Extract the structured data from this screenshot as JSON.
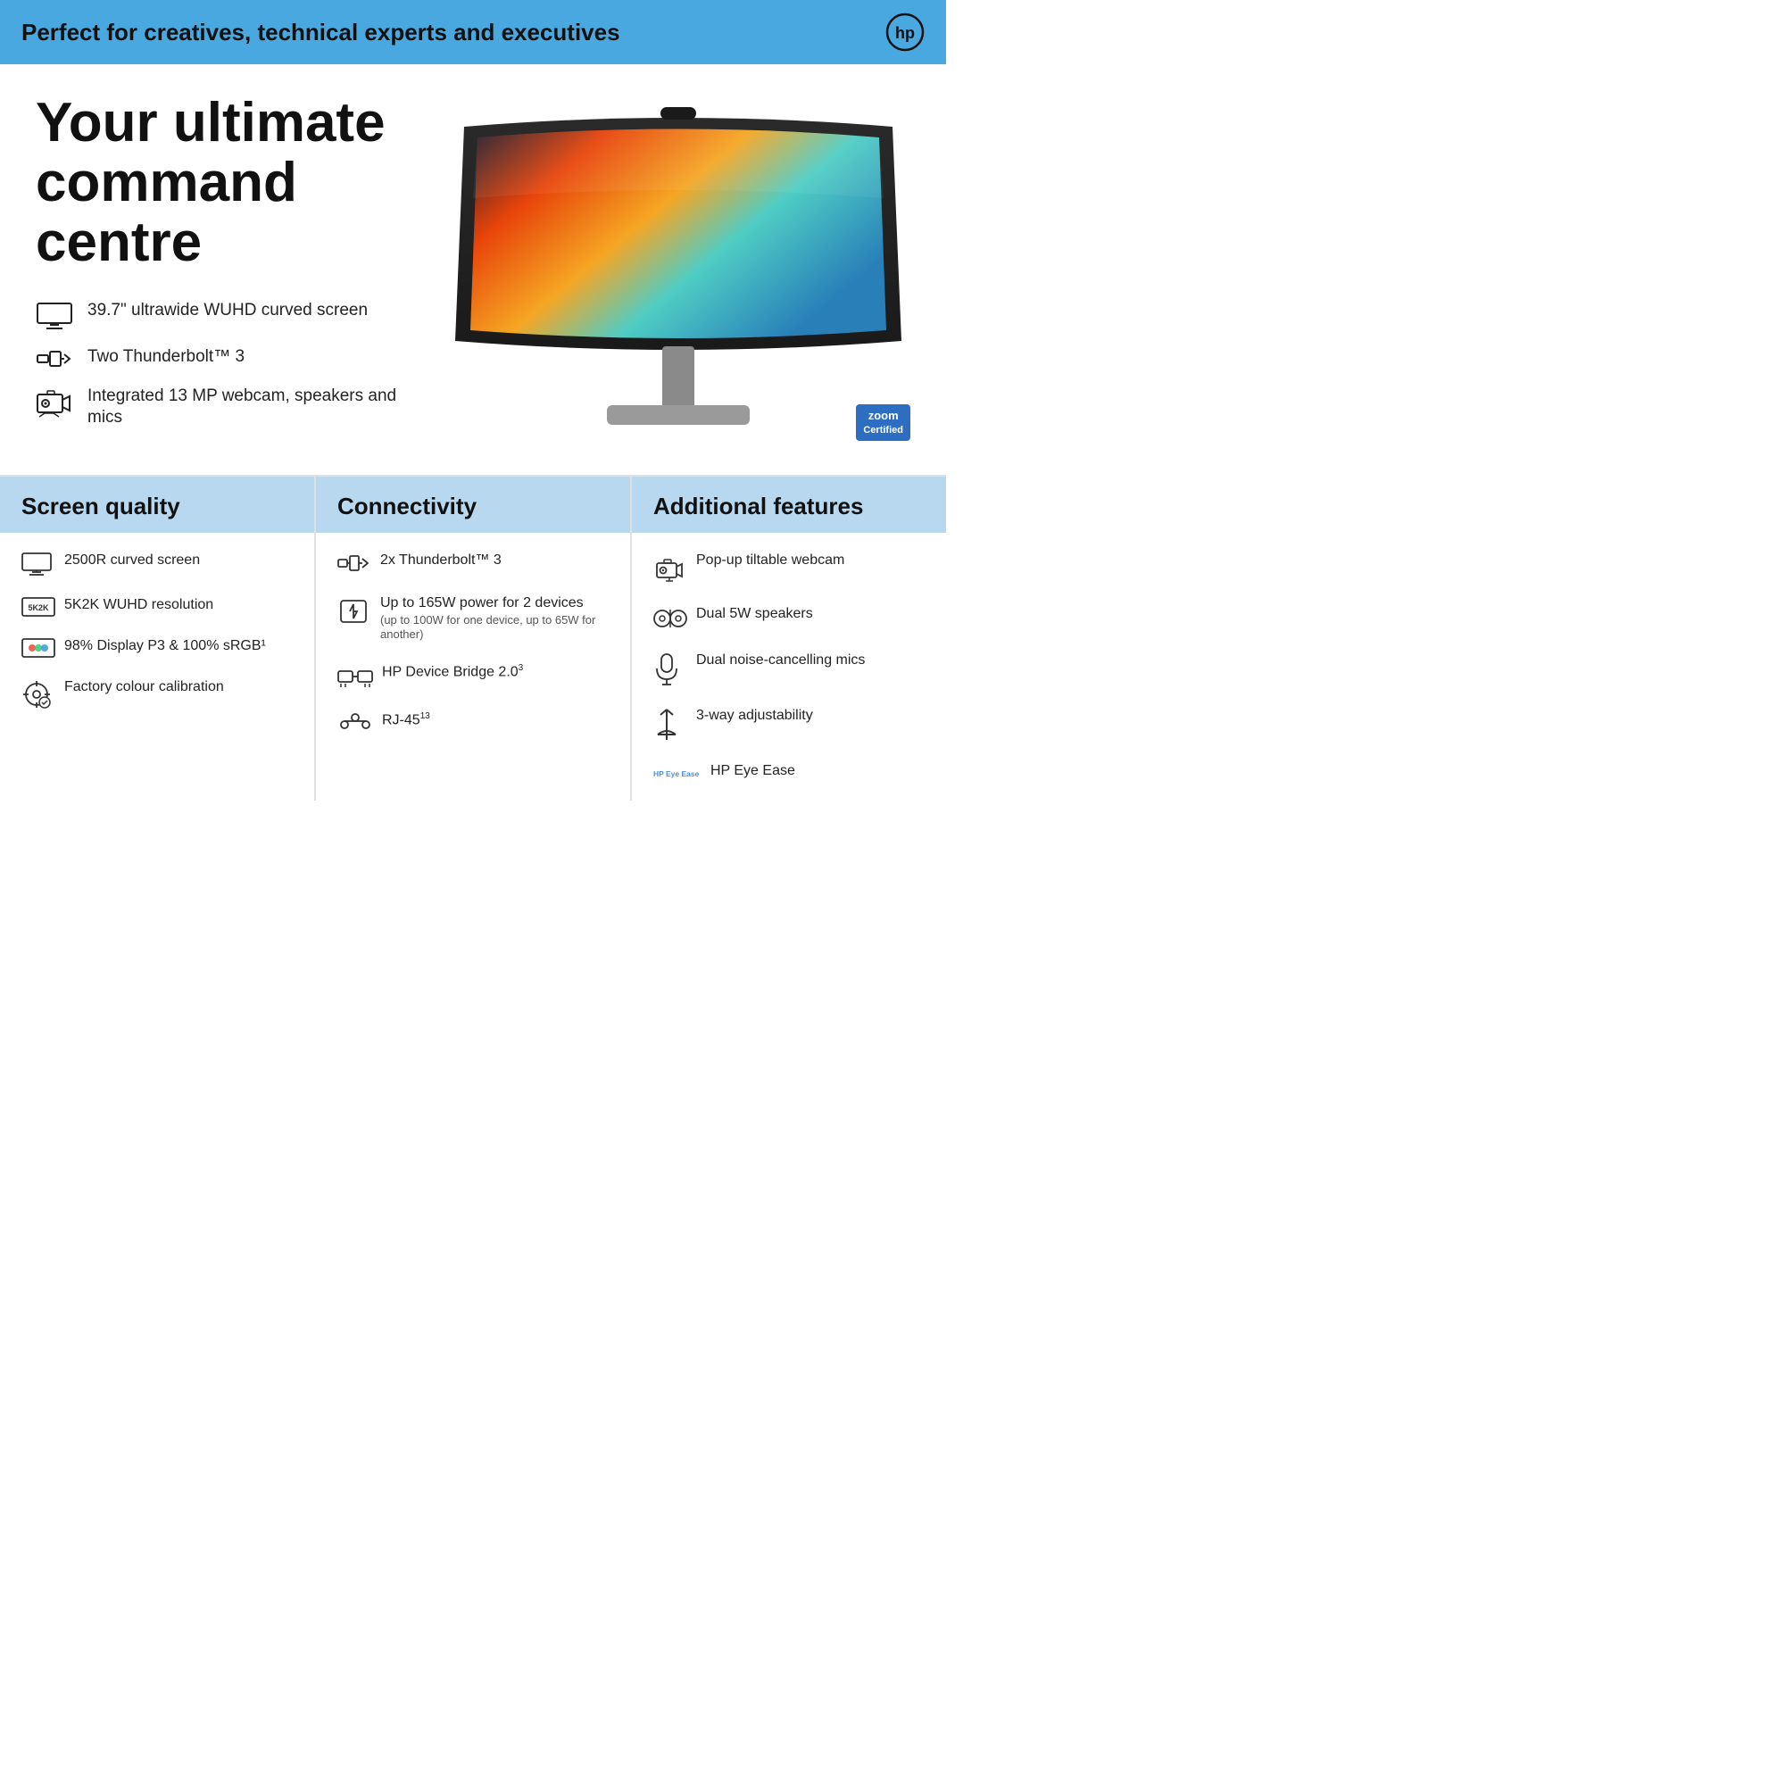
{
  "banner": {
    "text": "Perfect for creatives, technical experts and executives"
  },
  "hero": {
    "title": "Your ultimate command centre",
    "features": [
      {
        "icon": "monitor-icon",
        "text": "39.7\" ultrawide WUHD curved screen"
      },
      {
        "icon": "thunderbolt-icon",
        "text": "Two Thunderbolt™ 3"
      },
      {
        "icon": "webcam-icon",
        "text": "Integrated 13 MP webcam, speakers and mics"
      }
    ]
  },
  "zoom_badge": {
    "word": "zoom",
    "label": "Certified"
  },
  "specs": {
    "columns": [
      {
        "header": "Screen quality",
        "items": [
          {
            "icon": "monitor-small-icon",
            "text": "2500R curved screen"
          },
          {
            "icon": "5k2k-icon",
            "text": "5K2K WUHD resolution"
          },
          {
            "icon": "colors-icon",
            "text": "98% Display P3 & 100% sRGB¹"
          },
          {
            "icon": "calibration-icon",
            "text": "Factory colour calibration"
          }
        ]
      },
      {
        "header": "Connectivity",
        "items": [
          {
            "icon": "tb-icon",
            "text": "2x Thunderbolt™ 3",
            "sub": ""
          },
          {
            "icon": "power-icon",
            "text": "Up to 165W power for 2 devices",
            "sub": "(up to 100W for one device, up to 65W for another)"
          },
          {
            "icon": "bridge-icon",
            "text": "HP Device Bridge 2.0³",
            "sub": ""
          },
          {
            "icon": "rj45-icon",
            "text": "RJ-45¹³",
            "sub": ""
          }
        ]
      },
      {
        "header": "Additional features",
        "items": [
          {
            "icon": "popup-webcam-icon",
            "text": "Pop-up tiltable webcam"
          },
          {
            "icon": "speakers-icon",
            "text": "Dual 5W speakers"
          },
          {
            "icon": "mic-icon",
            "text": "Dual noise-cancelling mics"
          },
          {
            "icon": "adjust-icon",
            "text": "3-way adjustability"
          },
          {
            "icon": "eyeease-icon",
            "text": "HP Eye Ease",
            "prefix": "HP Eye Ease"
          }
        ]
      }
    ]
  }
}
